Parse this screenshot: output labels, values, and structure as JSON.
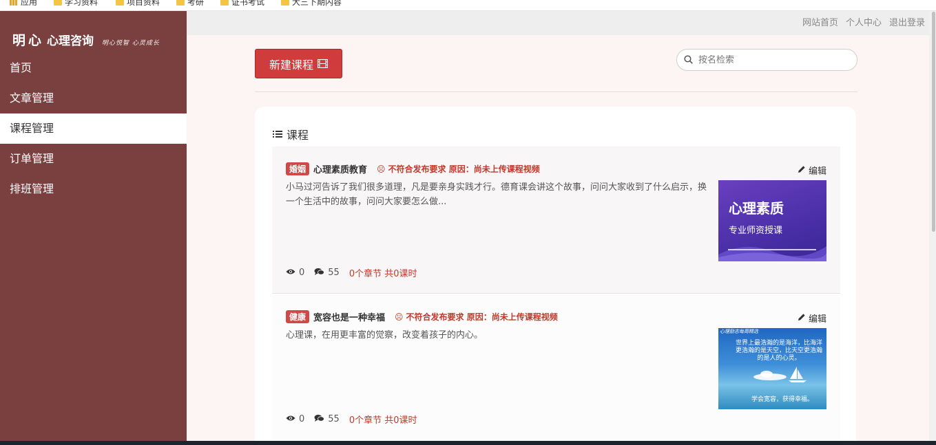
{
  "browser": {
    "bookmarks": [
      {
        "label": "应用",
        "icon": "apps-icon"
      },
      {
        "label": "学习资料",
        "icon": "folder-icon"
      },
      {
        "label": "项目资料",
        "icon": "folder-icon"
      },
      {
        "label": "考研",
        "icon": "folder-icon"
      },
      {
        "label": "证书考试",
        "icon": "folder-icon"
      },
      {
        "label": "大三下期内容",
        "icon": "folder-icon"
      }
    ]
  },
  "brand": {
    "logo": "明心",
    "name": "心理咨询",
    "slogan": "明心悦智 心灵成长"
  },
  "sidebar": {
    "items": [
      {
        "label": "首页",
        "active": false
      },
      {
        "label": "文章管理",
        "active": false
      },
      {
        "label": "课程管理",
        "active": true
      },
      {
        "label": "订单管理",
        "active": false
      },
      {
        "label": "排班管理",
        "active": false
      }
    ]
  },
  "header": {
    "links": [
      "网站首页",
      "个人中心",
      "退出登录"
    ]
  },
  "toolbar": {
    "new_course_label": "新建课程",
    "search_placeholder": "按名检索"
  },
  "panel": {
    "title": "课程"
  },
  "courses": [
    {
      "tag": "婚姻",
      "title": "心理素质教育",
      "status": "不符合发布要求 原因：尚未上传课程视频",
      "description": "小马过河告诉了我们很多道理，凡是要亲身实践才行。德育课会讲这个故事，问问大家收到了什么启示，换一个生活中的故事，问问大家要怎么做...",
      "views": "0",
      "comments": "55",
      "chapters": "0个章节 共0课时",
      "edit_label": "编辑",
      "thumb_title": "心理素质",
      "thumb_sub": "专业师资授课"
    },
    {
      "tag": "健康",
      "title": "宽容也是一种幸福",
      "status": "不符合发布要求 原因：尚未上传课程视频",
      "description": "心理课，在用更丰富的觉察，改变着孩子的内心。",
      "views": "0",
      "comments": "55",
      "chapters": "0个章节 共0课时",
      "edit_label": "编辑",
      "thumb_corner": "心理励志每周精选",
      "thumb_lines": "世界上最浩瀚的是海洋，比海洋更浩瀚的是天空，比天空更浩瀚的是人的心灵。",
      "thumb_bottom": "学会宽容，获得幸福。"
    }
  ],
  "colors": {
    "sidebar": "#7a4040",
    "accent": "#d03b3b",
    "content_bg": "#fdf4f4",
    "status_red": "#c0392b"
  }
}
